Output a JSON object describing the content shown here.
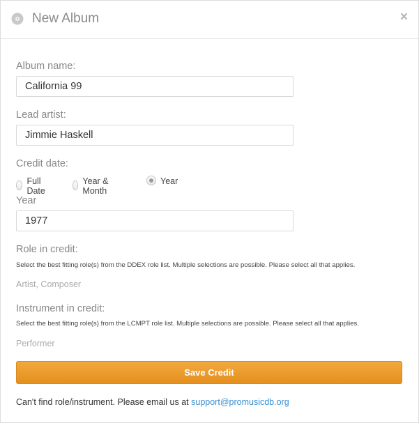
{
  "dialog": {
    "title": "New Album",
    "close_label": "×"
  },
  "form": {
    "album_name": {
      "label": "Album name:",
      "value": "California 99"
    },
    "lead_artist": {
      "label": "Lead artist:",
      "value": "Jimmie Haskell"
    },
    "credit_date": {
      "label": "Credit date:",
      "options": [
        {
          "label": "Full Date",
          "checked": false
        },
        {
          "label": "Year & Month",
          "checked": false
        },
        {
          "label": "Year",
          "checked": true
        }
      ]
    },
    "year": {
      "label": "Year",
      "value": "1977"
    },
    "role": {
      "label": "Role in credit:",
      "help": "Select the best fitting role(s) from the DDEX role list. Multiple selections are possible. Please select all that applies.",
      "placeholder": "Artist, Composer"
    },
    "instrument": {
      "label": "Instrument in credit:",
      "help": "Select the best fitting role(s) from the LCMPT role list. Multiple selections are possible. Please select all that applies.",
      "placeholder": "Performer"
    },
    "save_label": "Save Credit"
  },
  "footer": {
    "text": "Can't find role/instrument. Please email us at ",
    "email": "support@promusicdb.org"
  },
  "colors": {
    "accent": "#e8962a",
    "link": "#3a8fd0"
  }
}
